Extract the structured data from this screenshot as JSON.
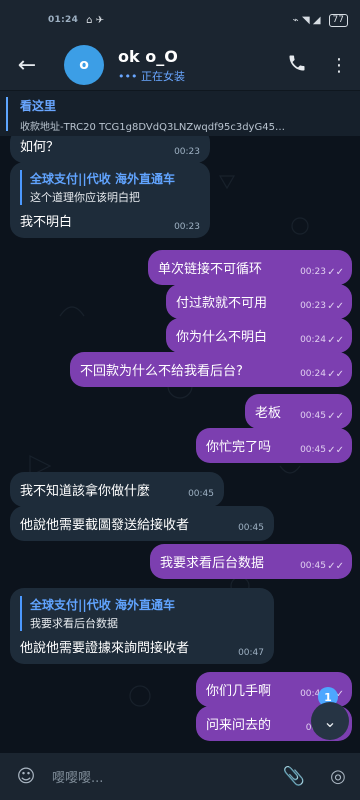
{
  "status": {
    "time": "01:24",
    "left_glyphs": "⌂ ✈",
    "right_glyphs": "⌁ ◥ ◢",
    "battery": "77"
  },
  "header": {
    "title": "ok o_O",
    "subtitle": "正在女装"
  },
  "pinned": {
    "title": "看这里",
    "content": "收款地址-TRC20    TCG1g8DVdQ3LNZwqdf95c3dyG45…"
  },
  "messages": [
    {
      "type": "in",
      "text": "如何？",
      "time": "00:23"
    },
    {
      "type": "in_reply",
      "reply_title": "全球支付||代收 海外直通车",
      "reply_text": "这个道理你应该明白把",
      "text": "我不明白",
      "time": "00:23"
    },
    {
      "type": "out",
      "text": "单次链接不可循环",
      "time": "00:23"
    },
    {
      "type": "out",
      "text": "付过款就不可用",
      "time": "00:23"
    },
    {
      "type": "out",
      "text": "你为什么不明白",
      "time": "00:24"
    },
    {
      "type": "out",
      "text": "不回款为什么不给我看后台?",
      "time": "00:24"
    },
    {
      "type": "out",
      "text": "老板",
      "time": "00:45"
    },
    {
      "type": "out",
      "text": "你忙完了吗",
      "time": "00:45"
    },
    {
      "type": "in",
      "text": "我不知道該拿你做什麼",
      "time": "00:45"
    },
    {
      "type": "in",
      "text": "他說他需要截圖發送給接收者",
      "time": "00:45"
    },
    {
      "type": "out",
      "text": "我要求看后台数据",
      "time": "00:45"
    },
    {
      "type": "in_reply",
      "reply_title": "全球支付||代收 海外直通车",
      "reply_text": "我要求看后台数据",
      "text": "他說他需要證據來詢問接收者",
      "time": "00:47"
    },
    {
      "type": "out",
      "text": "你们几手啊",
      "time": "00:47"
    },
    {
      "type": "out",
      "text": "问来问去的",
      "time": "00:4"
    }
  ],
  "input": {
    "placeholder": "嘤嘤嘤..."
  },
  "fab": {
    "badge": "1"
  }
}
